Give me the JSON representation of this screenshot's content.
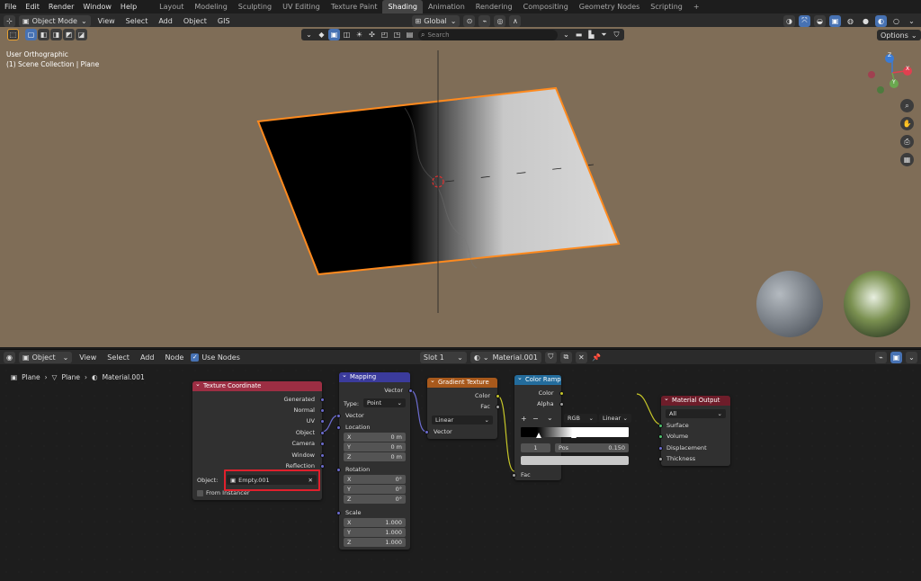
{
  "menu": [
    "File",
    "Edit",
    "Render",
    "Window",
    "Help"
  ],
  "workspaces": [
    {
      "label": "Layout"
    },
    {
      "label": "Modeling"
    },
    {
      "label": "Sculpting"
    },
    {
      "label": "UV Editing"
    },
    {
      "label": "Texture Paint"
    },
    {
      "label": "Shading",
      "active": true
    },
    {
      "label": "Animation"
    },
    {
      "label": "Rendering"
    },
    {
      "label": "Compositing"
    },
    {
      "label": "Geometry Nodes"
    },
    {
      "label": "Scripting"
    },
    {
      "label": "+"
    }
  ],
  "viewport_header": {
    "mode": "Object Mode",
    "menus": [
      "View",
      "Select",
      "Add",
      "Object",
      "GIS"
    ],
    "orientation": "Global",
    "search_placeholder": "Search",
    "options": "Options"
  },
  "viewport": {
    "view_name": "User Orthographic",
    "collection": "(1) Scene Collection | Plane",
    "gizmo": {
      "x": "X",
      "y": "Y",
      "z": "Z"
    }
  },
  "node_header": {
    "object_type": "Object",
    "menus": [
      "View",
      "Select",
      "Add",
      "Node"
    ],
    "use_nodes": "Use Nodes",
    "slot": "Slot 1",
    "material": "Material.001"
  },
  "breadcrumb": [
    "Plane",
    "Plane",
    "Material.001"
  ],
  "nodes": {
    "texcoord": {
      "title": "Texture Coordinate",
      "outputs": [
        "Generated",
        "Normal",
        "UV",
        "Object",
        "Camera",
        "Window",
        "Reflection"
      ],
      "object_label": "Object:",
      "object_value": "Empty.001",
      "from_instancer": "From Instancer"
    },
    "mapping": {
      "title": "Mapping",
      "output": "Vector",
      "type_label": "Type:",
      "type_value": "Point",
      "vector_in": "Vector",
      "location": "Location",
      "loc": [
        {
          "a": "X",
          "v": "0 m"
        },
        {
          "a": "Y",
          "v": "0 m"
        },
        {
          "a": "Z",
          "v": "0 m"
        }
      ],
      "rotation": "Rotation",
      "rot": [
        {
          "a": "X",
          "v": "0°"
        },
        {
          "a": "Y",
          "v": "0°"
        },
        {
          "a": "Z",
          "v": "0°"
        }
      ],
      "scale": "Scale",
      "scl": [
        {
          "a": "X",
          "v": "1.000"
        },
        {
          "a": "Y",
          "v": "1.000"
        },
        {
          "a": "Z",
          "v": "1.000"
        }
      ]
    },
    "gradient": {
      "title": "Gradient Texture",
      "out_color": "Color",
      "out_fac": "Fac",
      "type": "Linear",
      "vector_in": "Vector"
    },
    "colorramp": {
      "title": "Color Ramp",
      "out_color": "Color",
      "out_alpha": "Alpha",
      "plus": "+",
      "minus": "−",
      "mode": "RGB",
      "interp": "Linear",
      "index": "1",
      "pos_label": "Pos",
      "pos_value": "0.150",
      "fac_in": "Fac"
    },
    "output": {
      "title": "Material Output",
      "target": "All",
      "inputs": [
        "Surface",
        "Volume",
        "Displacement",
        "Thickness"
      ]
    }
  },
  "colors": {
    "viewport_bg": "#7f6d57",
    "selection": "#ff8a1e",
    "texcoord_header": "#9c2e43",
    "vector_header": "#3b3b9c",
    "texture_header": "#a8591c",
    "converter_header": "#236c9c",
    "output_header": "#6e1d2a",
    "highlight": "#e0202c"
  }
}
